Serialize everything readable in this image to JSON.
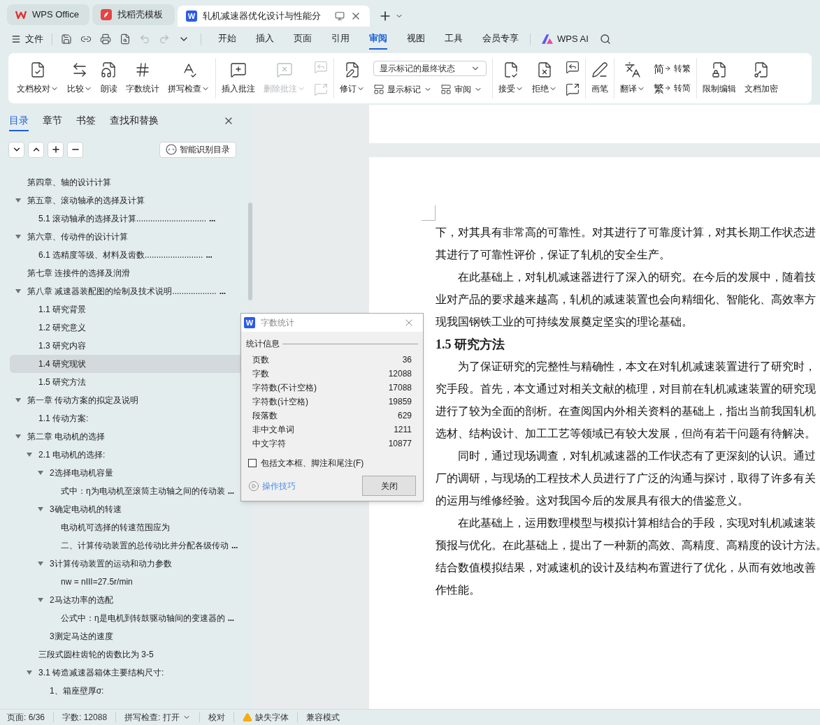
{
  "tabs": [
    {
      "kind": "wps",
      "label": "WPS Office",
      "selected": false
    },
    {
      "kind": "template",
      "label": "找稻壳模板",
      "selected": false
    },
    {
      "kind": "doc",
      "logo_text": "W",
      "label": "轧机减速器优化设计与性能分",
      "selected": true
    }
  ],
  "menu": {
    "file": "文件",
    "tabs": [
      {
        "label": "开始",
        "selected": false
      },
      {
        "label": "插入",
        "selected": false
      },
      {
        "label": "页面",
        "selected": false
      },
      {
        "label": "引用",
        "selected": false
      },
      {
        "label": "审阅",
        "selected": true
      },
      {
        "label": "视图",
        "selected": false
      },
      {
        "label": "工具",
        "selected": false
      },
      {
        "label": "会员专享",
        "selected": false
      }
    ],
    "ai": "WPS AI"
  },
  "ribbon": [
    {
      "items": [
        {
          "kind": "large",
          "label": "文档校对",
          "dropdown": true,
          "disabled": false
        },
        {
          "kind": "large",
          "label": "比较",
          "dropdown": true,
          "disabled": false
        },
        {
          "kind": "large",
          "label": "朗读",
          "dropdown": false,
          "disabled": false
        },
        {
          "kind": "large",
          "label": "字数统计",
          "dropdown": false,
          "disabled": false
        },
        {
          "kind": "large",
          "label": "拼写检查",
          "dropdown": true,
          "disabled": false
        }
      ]
    },
    {
      "items": [
        {
          "kind": "large",
          "label": "插入批注",
          "dropdown": false,
          "disabled": false
        },
        {
          "kind": "large",
          "label": "删除批注",
          "dropdown": true,
          "disabled": true
        },
        {
          "kind": "icon-pair",
          "disabled": true
        }
      ]
    },
    {
      "items": [
        {
          "kind": "large",
          "label": "修订",
          "dropdown": true,
          "disabled": false
        },
        {
          "kind": "stack",
          "items": [
            {
              "kind": "select",
              "value": "显示标记的最终状态"
            },
            {
              "kind": "row",
              "items": [
                {
                  "kind": "small",
                  "label": "显示标记",
                  "dropdown": true
                },
                {
                  "kind": "small",
                  "label": "审阅",
                  "dropdown": true
                }
              ]
            }
          ]
        }
      ]
    },
    {
      "items": [
        {
          "kind": "large",
          "label": "接受",
          "dropdown": true,
          "disabled": false
        },
        {
          "kind": "large",
          "label": "拒绝",
          "dropdown": true,
          "disabled": false
        },
        {
          "kind": "icon-pair",
          "disabled": false
        }
      ]
    },
    {
      "items": [
        {
          "kind": "large",
          "label": "画笔",
          "dropdown": false,
          "disabled": false
        }
      ]
    },
    {
      "items": [
        {
          "kind": "large",
          "label": "翻译",
          "dropdown": true,
          "disabled": false
        },
        {
          "kind": "stack",
          "items": [
            {
              "kind": "small",
              "glyph": "简",
              "label": "转繁",
              "dropdown": false
            },
            {
              "kind": "small",
              "glyph": "繁",
              "label": "转简",
              "dropdown": false
            }
          ]
        }
      ]
    },
    {
      "items": [
        {
          "kind": "large",
          "label": "限制编辑",
          "dropdown": false,
          "disabled": false
        },
        {
          "kind": "large",
          "label": "文档加密",
          "dropdown": false,
          "disabled": false
        }
      ]
    }
  ],
  "nav": {
    "tabs": [
      {
        "label": "目录",
        "selected": true
      },
      {
        "label": "章节",
        "selected": false
      },
      {
        "label": "书签",
        "selected": false
      },
      {
        "label": "查找和替换",
        "selected": false
      }
    ],
    "smart_button": "智能识别目录",
    "tree": [
      {
        "text": "第四章、轴的设计计算",
        "selected": false
      },
      {
        "text": "第五章、滚动轴承的选择及计算",
        "selected": false,
        "expanded": true,
        "children": [
          {
            "text": "5.1  滚动轴承的选择及计算..............................",
            "tail": "...",
            "selected": false
          }
        ]
      },
      {
        "text": "第六章、传动件的设计计算",
        "selected": false,
        "expanded": true,
        "children": [
          {
            "text": "6.1  选精度等级、材料及齿数.........................",
            "tail": "...",
            "selected": false
          }
        ]
      },
      {
        "text": "第七章   连接件的选择及润滑",
        "selected": false
      },
      {
        "text": "第八章   减速器装配图的绘制及技术说明...................",
        "tail": "...",
        "selected": false,
        "expanded": true,
        "children": [
          {
            "text": "1.1  研究背景",
            "selected": false
          },
          {
            "text": "1.2  研究意义",
            "selected": false
          },
          {
            "text": "1.3  研究内容",
            "selected": false
          },
          {
            "text": "1.4  研究现状",
            "selected": true
          },
          {
            "text": "1.5  研究方法",
            "selected": false
          }
        ]
      },
      {
        "text": "第一章  传动方案的拟定及说明",
        "selected": false,
        "expanded": true,
        "children": [
          {
            "text": "1.1  传动方案:",
            "selected": false
          }
        ]
      },
      {
        "text": "第二章   电动机的选择",
        "selected": false,
        "expanded": true,
        "children": [
          {
            "text": "2.1  电动机的选择:",
            "selected": false,
            "expanded": true,
            "children": [
              {
                "text": "2选择电动机容量",
                "selected": false,
                "expanded": true,
                "children": [
                  {
                    "text": "式中：η为电动机至滚筒主动轴之间的传动装",
                    "tail": "...",
                    "selected": false
                  }
                ]
              },
              {
                "text": "3确定电动机的转速",
                "selected": false,
                "expanded": true,
                "children": [
                  {
                    "text": "电动机可选择的转速范围应为",
                    "selected": false
                  },
                  {
                    "text": "二、计算传动装置的总传动比并分配各级传动",
                    "tail": "...",
                    "selected": false
                  }
                ]
              },
              {
                "text": "3计算传动装置的运动和动力参数",
                "selected": false,
                "expanded": true,
                "children": [
                  {
                    "text": "nw = nIII=27.5r/min",
                    "selected": false
                  }
                ]
              },
              {
                "text": "2马达功率的选配",
                "selected": false,
                "expanded": true,
                "children": [
                  {
                    "text": "公式中：η是电机到转鼓驱动轴间的变速器的",
                    "tail": "...",
                    "selected": false
                  }
                ]
              },
              {
                "text": "3测定马达的速度",
                "selected": false
              }
            ]
          },
          {
            "text": "三段式圆柱齿轮的齿数比为 3-5",
            "selected": false
          },
          {
            "text": "3.1  铸造减速器箱体主要结构尺寸:",
            "selected": false,
            "expanded": true,
            "children": [
              {
                "text": "1、箱座壁厚σ:",
                "selected": false
              }
            ]
          }
        ]
      }
    ]
  },
  "document": [
    {
      "kind": "continuation",
      "lines": [
        "下，对其具有非常高的可靠性。对其进行了可靠度计算，对其长期工作状态进",
        "其进行了可靠性评价，保证了轧机的安全生产。"
      ]
    },
    {
      "kind": "paragraph",
      "lines": [
        "在此基础上，对轧机减速器进行了深入的研究。在今后的发展中，随着技",
        "业对产品的要求越来越高，轧机的减速装置也会向精细化、智能化、高效率方",
        "现我国钢铁工业的可持续发展奠定坚实的理论基础。"
      ]
    },
    {
      "kind": "heading",
      "lines": [
        "1.5  研究方法"
      ]
    },
    {
      "kind": "paragraph",
      "lines": [
        "为了保证研究的完整性与精确性，本文在对轧机减速装置进行了研究时，",
        "究手段。首先，本文通过对相关文献的梳理，对目前在轧机减速装置的研究现",
        "进行了较为全面的剖析。在查阅国内外相关资料的基础上，指出当前我国轧机",
        "选材、结构设计、加工工艺等领域已有较大发展，但尚有若干问题有待解决。"
      ]
    },
    {
      "kind": "paragraph",
      "lines": [
        "同时，通过现场调查，对轧机减速器的工作状态有了更深刻的认识。通过",
        "厂的调研，与现场的工程技术人员进行了广泛的沟通与探讨，取得了许多有关",
        "的运用与维修经验。这对我国今后的发展具有很大的借鉴意义。"
      ]
    },
    {
      "kind": "paragraph",
      "lines": [
        "在此基础上，运用数理模型与模拟计算相结合的手段，实现对轧机减速装",
        "预报与优化。在此基础上，提出了一种新的高效、高精度、高精度的设计方法。",
        "结合数值模拟结果，对减速机的设计及结构布置进行了优化，从而有效地改善",
        "作性能。"
      ]
    }
  ],
  "dialog": {
    "logo_text": "W",
    "title": "字数统计",
    "group": "统计信息",
    "rows": [
      {
        "label": "页数",
        "value": "36"
      },
      {
        "label": "字数",
        "value": "12088"
      },
      {
        "label": "字符数(不计空格)",
        "value": "17088"
      },
      {
        "label": "字符数(计空格)",
        "value": "19859"
      },
      {
        "label": "段落数",
        "value": "629"
      },
      {
        "label": "非中文单词",
        "value": "1211"
      },
      {
        "label": "中文字符",
        "value": "10877"
      }
    ],
    "checkbox": {
      "label": "包括文本框、脚注和尾注(F)",
      "checked": false
    },
    "tips": "操作技巧",
    "close": "关闭"
  },
  "status_bar": [
    {
      "kind": "text",
      "text": "页面: 6/36"
    },
    {
      "kind": "text",
      "text": "字数: 12088"
    },
    {
      "kind": "dropdown",
      "text": "拼写检查: 打开"
    },
    {
      "kind": "text",
      "text": "校对"
    },
    {
      "kind": "warning",
      "text": "缺失字体"
    },
    {
      "kind": "text",
      "text": "兼容模式"
    }
  ]
}
